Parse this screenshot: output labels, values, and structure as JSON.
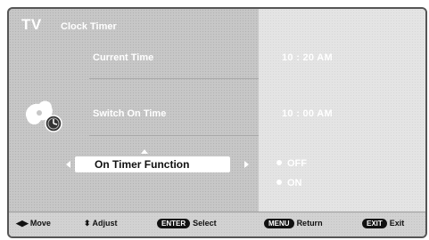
{
  "header": {
    "tv": "TV",
    "menu_title": "Clock Timer"
  },
  "rows": [
    {
      "label": "Current Time",
      "value": "10 : 20  AM"
    },
    {
      "label": "Switch On Time",
      "value": "10 : 00  AM"
    }
  ],
  "selected_row": {
    "label": "On Timer Function"
  },
  "options": [
    {
      "label": "OFF"
    },
    {
      "label": "ON"
    }
  ],
  "footer": {
    "move": "Move",
    "adjust": "Adjust",
    "enter_key": "ENTER",
    "select": "Select",
    "menu_key": "MENU",
    "return": "Return",
    "exit_key": "EXIT",
    "exit": "Exit"
  },
  "icons": {
    "move": "left-right-arrows-icon",
    "adjust": "up-down-arrows-icon",
    "clock": "clock-icon"
  }
}
